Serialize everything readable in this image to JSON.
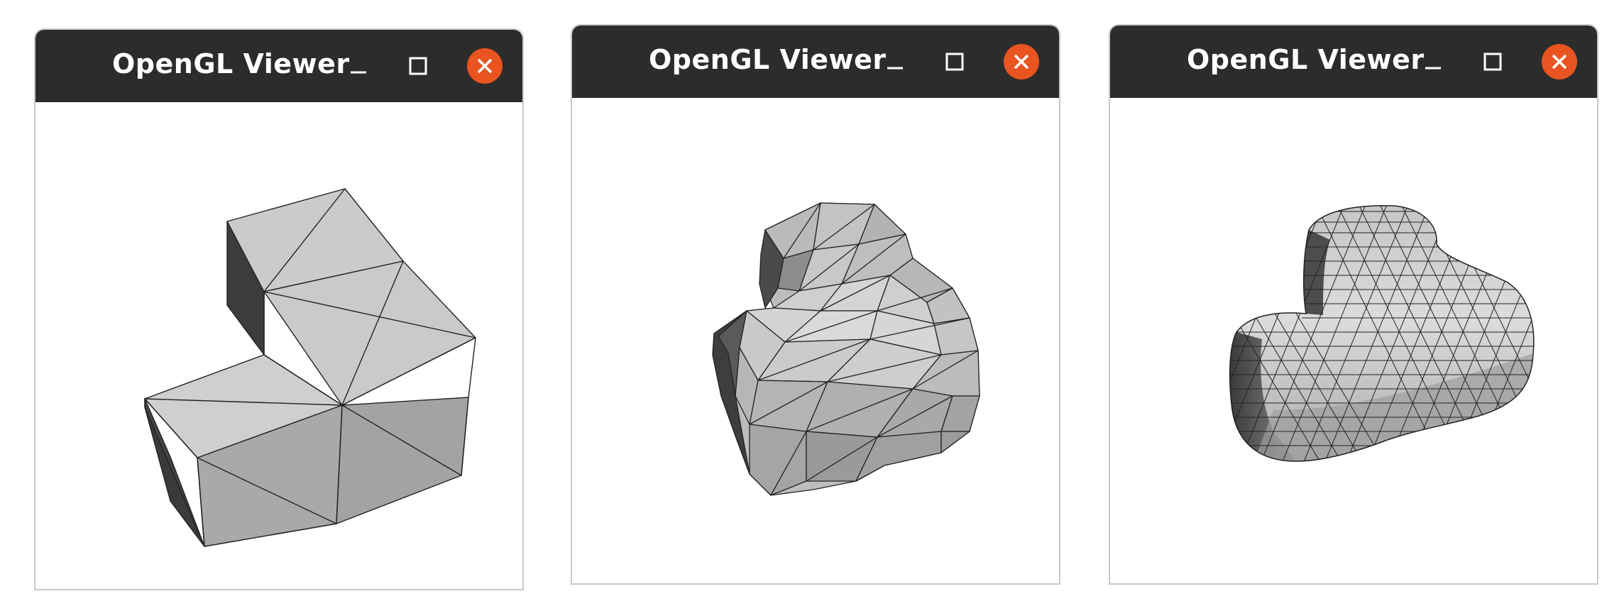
{
  "windows": [
    {
      "title": "OpenGL Viewer",
      "minimize_icon": "minimize-icon",
      "maximize_icon": "maximize-icon",
      "close_icon": "close-icon"
    },
    {
      "title": "OpenGL Viewer",
      "minimize_icon": "minimize-icon",
      "maximize_icon": "maximize-icon",
      "close_icon": "close-icon"
    },
    {
      "title": "OpenGL Viewer",
      "minimize_icon": "minimize-icon",
      "maximize_icon": "maximize-icon",
      "close_icon": "close-icon"
    }
  ],
  "colors": {
    "titlebar": "#2c2c2c",
    "close_button": "#e95420",
    "mesh_light": "#cfcfcf",
    "mesh_mid": "#a4a4a4",
    "mesh_dark": "#3c3c3c"
  }
}
